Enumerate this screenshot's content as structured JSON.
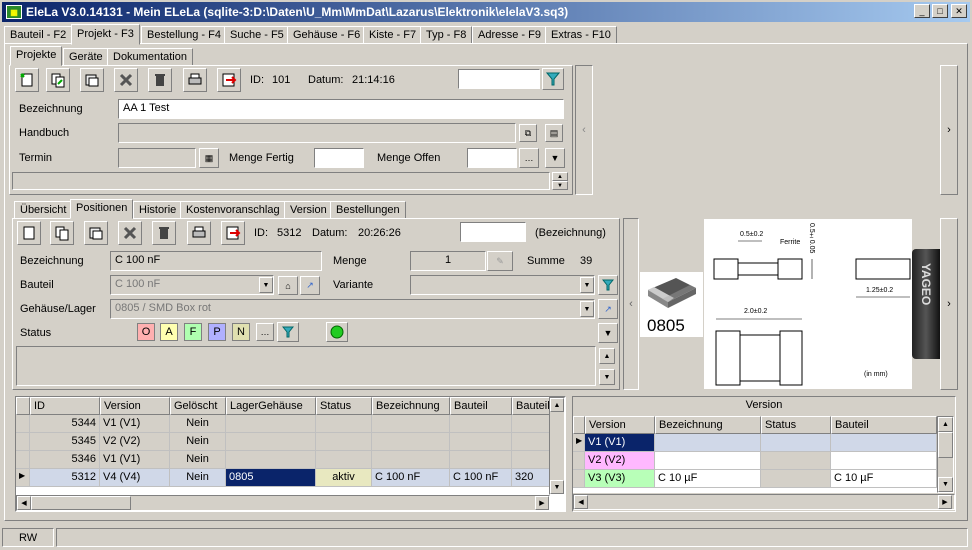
{
  "window": {
    "title": "EleLa V3.0.14131  - Mein ELeLa (sqlite-3:D:\\Daten\\U_Mm\\MmDat\\Lazarus\\Elektronik\\elelaV3.sq3)"
  },
  "main_tabs": [
    {
      "label": "Bauteil - F2"
    },
    {
      "label": "Projekt - F3"
    },
    {
      "label": "Bestellung - F4"
    },
    {
      "label": "Suche - F5"
    },
    {
      "label": "Gehäuse - F6"
    },
    {
      "label": "Kiste - F7"
    },
    {
      "label": "Typ - F8"
    },
    {
      "label": "Adresse - F9"
    },
    {
      "label": "Extras - F10"
    }
  ],
  "sub_tabs": [
    {
      "label": "Projekte"
    },
    {
      "label": "Geräte"
    },
    {
      "label": "Dokumentation"
    }
  ],
  "project": {
    "id_label": "ID:",
    "id_value": "101",
    "datum_label": "Datum:",
    "datum_value": "21:14:16",
    "bezeichnung_label": "Bezeichnung",
    "bezeichnung_value": "AA 1 Test",
    "handbuch_label": "Handbuch",
    "termin_label": "Termin",
    "menge_fertig_label": "Menge Fertig",
    "menge_offen_label": "Menge Offen"
  },
  "pos_tabs": [
    {
      "label": "Übersicht"
    },
    {
      "label": "Positionen"
    },
    {
      "label": "Historie"
    },
    {
      "label": "Kostenvoranschlag"
    },
    {
      "label": "Version"
    },
    {
      "label": "Bestellungen"
    }
  ],
  "position": {
    "id_label": "ID:",
    "id_value": "5312",
    "datum_label": "Datum:",
    "datum_value": "20:26:26",
    "search_hint": "(Bezeichnung)",
    "bezeichnung_label": "Bezeichnung",
    "bezeichnung_value": "C 100 nF",
    "menge_label": "Menge",
    "menge_value": "1",
    "summe_label": "Summe",
    "summe_value": "39",
    "bauteil_label": "Bauteil",
    "bauteil_value": "C 100 nF",
    "variante_label": "Variante",
    "gehaeuse_label": "Gehäuse/Lager",
    "gehaeuse_value": "0805 / SMD Box rot",
    "status_label": "Status",
    "status_buttons": [
      "O",
      "A",
      "F",
      "P",
      "N"
    ],
    "status_colors": [
      "#ffb0b0",
      "#ffffb0",
      "#b0ffb0",
      "#b0b0ff",
      "#e0e0b0"
    ]
  },
  "image": {
    "package_label": "0805",
    "dim1": "0.5±0.2",
    "dim2": "Ferrite",
    "dim3": "0.5±0.05",
    "dim4": "1.25±0.2",
    "dim5": "2.0±0.2",
    "unit_note": "(in mm)",
    "yageo": "YAGEO"
  },
  "positions_table": {
    "columns": [
      "ID",
      "Version",
      "Gelöscht",
      "LagerGehäuse",
      "Status",
      "Bezeichnung",
      "Bauteil",
      "Bauteil"
    ],
    "rows": [
      [
        "5344",
        "V1 (V1)",
        "Nein",
        "",
        "",
        "",
        "",
        ""
      ],
      [
        "5345",
        "V2 (V2)",
        "Nein",
        "",
        "",
        "",
        "",
        ""
      ],
      [
        "5346",
        "V1 (V1)",
        "Nein",
        "",
        "",
        "",
        "",
        ""
      ],
      [
        "5312",
        "V4 (V4)",
        "Nein",
        "0805",
        "aktiv",
        "C 100 nF",
        "C 100 nF",
        "320"
      ]
    ]
  },
  "version_table": {
    "title": "Version",
    "columns": [
      "Version",
      "Bezeichnung",
      "Status",
      "Bauteil"
    ],
    "rows": [
      [
        "V1 (V1)",
        "",
        "",
        ""
      ],
      [
        "V2 (V2)",
        "",
        "",
        ""
      ],
      [
        "V3 (V3)",
        "C 10 µF",
        "",
        "C 10 µF"
      ]
    ]
  },
  "statusbar": {
    "mode": "RW"
  }
}
